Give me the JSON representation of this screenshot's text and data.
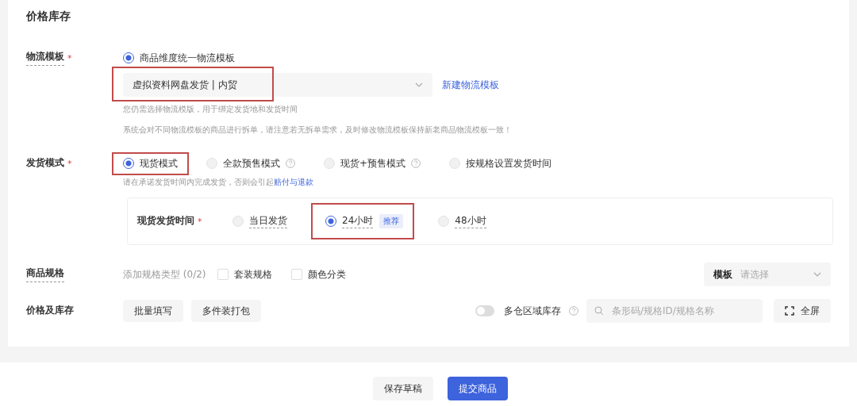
{
  "section_title": "价格库存",
  "logistics": {
    "label": "物流模板",
    "required_mark": "*",
    "options": [
      {
        "label": "商品维度统一物流模板",
        "selected": true
      }
    ],
    "select": {
      "value": "虚拟资料网盘发货 | 内贸",
      "highlighted": true
    },
    "link": "新建物流模板",
    "hints": [
      "您仍需选择物流模版，用于绑定发货地和发货时间",
      "系统会对不同物流模板的商品进行拆单，请注意若无拆单需求，及时修改物流模板保持新老商品物流模板一致！"
    ]
  },
  "shipping_mode": {
    "label": "发货模式",
    "required_mark": "*",
    "options": [
      {
        "label": "现货模式",
        "selected": true,
        "help": false,
        "highlighted": true
      },
      {
        "label": "全款预售模式",
        "selected": false,
        "help": true,
        "highlighted": false
      },
      {
        "label": "现货+预售模式",
        "selected": false,
        "help": true,
        "highlighted": false
      },
      {
        "label": "按规格设置发货时间",
        "selected": false,
        "help": false,
        "highlighted": false
      }
    ],
    "hint": "请在承诺发货时间内完成发货，否则会引起",
    "hint_link": "赔付与退款"
  },
  "ship_time": {
    "label": "现货发货时间",
    "required_mark": "*",
    "options": [
      {
        "label": "当日发货",
        "selected": false,
        "highlighted": false
      },
      {
        "label": "24小时",
        "selected": true,
        "badge": "推荐",
        "highlighted": true
      },
      {
        "label": "48小时",
        "selected": false,
        "highlighted": false
      }
    ]
  },
  "spec": {
    "label": "商品规格",
    "add_hint": "添加规格类型 (0/2)",
    "options": [
      {
        "label": "套装规格",
        "checked": false
      },
      {
        "label": "颜色分类",
        "checked": false
      }
    ],
    "template": {
      "label": "模板",
      "placeholder": "请选择"
    }
  },
  "price_stock": {
    "label": "价格及库存",
    "buttons": [
      "批量填写",
      "多件装打包"
    ],
    "toggle": {
      "label": "多仓区域库存",
      "on": false
    },
    "search": {
      "placeholder": "条形码/规格ID/规格名称"
    },
    "fullscreen": "全屏"
  },
  "footer": {
    "buttons": [
      {
        "label": "保存草稿",
        "kind": "secondary"
      },
      {
        "label": "提交商品",
        "kind": "primary"
      }
    ]
  }
}
